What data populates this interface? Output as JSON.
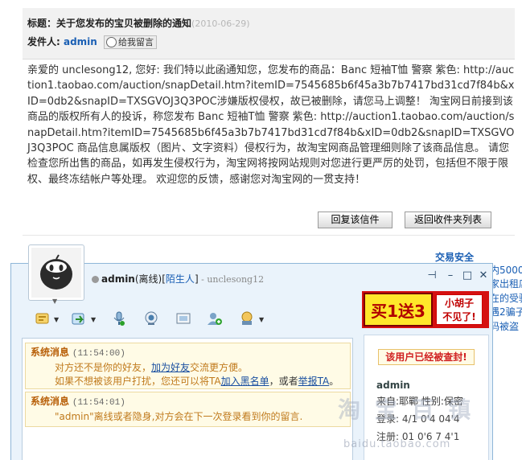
{
  "message": {
    "subject_label": "标题：",
    "subject": "关于您发布的宝贝被删除的通知",
    "date": "(2010-06-29)",
    "sender_label": "发件人: ",
    "sender": "admin",
    "leave_msg_label": "给我留言",
    "body": "亲爱的 unclesong12, 您好:        我们特以此函通知您，您发布的商品：Banc 短袖T恤 警察 紫色: http://auction1.taobao.com/auction/snapDetail.htm?itemID=7545685b6f45a3b7b7417bd31cd7f84b&xID=0db2&snapID=TXSGVOJ3Q3POC涉嫌版权侵权，故已被删除，请您马上调整！      淘宝网日前接到该商品的版权所有人的投诉，称您发布 Banc 短袖T恤 警察 紫色: http://auction1.taobao.com/auction/snapDetail.htm?itemID=7545685b6f45a3b7b7417bd31cd7f84b&xID=0db2&snapID=TXSGVOJ3Q3POC 商品信息属版权（图片、文字资料）侵权行为，故淘宝网商品管理细则除了该商品信息。 请您检查您所出售的商品，如再发生侵权行为，淘宝网将按网站规则对您进行更严厉的处罚，包括但不限于限权、最终冻结帐户等处理。 欢迎您的反馈，感谢您对淘宝网的一贯支持！",
    "reply_button": "回复该信件",
    "back_button": "返回收件夹列表"
  },
  "page_side": {
    "trade_safety": "交易安全",
    "side_links": [
      "内5000",
      "家出租店",
      "在的受骗",
      "遇2骗子",
      "码被盗"
    ]
  },
  "chat": {
    "contact_name": "admin",
    "status": "(离线)",
    "stranger_tag": "陌生人",
    "remark": " - unclesong12",
    "win_icons": {
      "pin": "⊣",
      "min": "–",
      "max": "□",
      "close": "✕"
    },
    "ad": {
      "main": "买1送3",
      "side_line1": "小胡子",
      "side_line2": "不见了!"
    },
    "toolbar_icons": [
      "emoticon-icon",
      "file-transfer-icon",
      "voice-icon",
      "video-icon",
      "screenshot-icon",
      "add-contact-icon",
      "more-apps-icon"
    ],
    "messages": [
      {
        "title": "系统消息",
        "time": "(11:54:00)",
        "line1_a": "对方还不是你的好友，",
        "line1_link": "加为好友",
        "line1_b": "交流更方便。",
        "line2_a": "如果不想被该用户打扰，您还可以将TA",
        "line2_link1": "加入黑名单",
        "line2_mid": "，或者",
        "line2_link2": "举报TA",
        "line2_end": "。"
      },
      {
        "title": "系统消息",
        "time": "(11:54:01)",
        "text": "\"admin\"离线或者隐身,对方会在下一次登录看到你的留言."
      }
    ],
    "info": {
      "closed_notice": "该用户已经被查封!",
      "name": "admin",
      "from": "来自:耶鄲   性别:保密",
      "login": "登录: 4/1 0'4 04'4",
      "reg": "注册: 01 0'6 7 4'1"
    },
    "watermark": "淘 宝 百 镇",
    "watermark_url": "baidu.taobao.com"
  },
  "colors": {
    "link": "#1a5fb4",
    "sys_title": "#b8600a",
    "sys_text": "#c07a1c",
    "notice_red": "#d02020",
    "chat_bg": "#eaf3fb"
  }
}
